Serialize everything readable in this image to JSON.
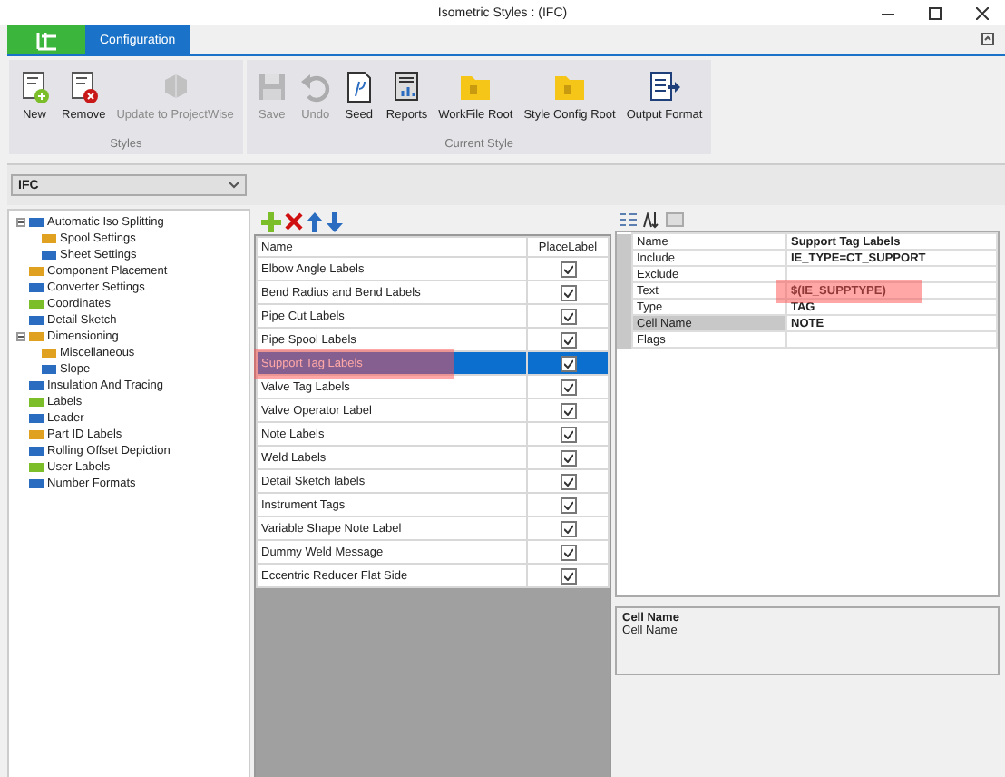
{
  "window": {
    "title": "Isometric Styles : (IFC)"
  },
  "ribbon": {
    "tabs": [
      {
        "label": "Configuration",
        "selected": true
      }
    ],
    "groups": [
      {
        "label": "Styles",
        "buttons": [
          {
            "label": "New",
            "kind": "new",
            "disabled": false
          },
          {
            "label": "Remove",
            "kind": "remove",
            "disabled": false
          },
          {
            "label": "Update to ProjectWise",
            "kind": "update",
            "disabled": true
          }
        ]
      },
      {
        "label": "Current Style",
        "buttons": [
          {
            "label": "Save",
            "kind": "save",
            "disabled": true
          },
          {
            "label": "Undo",
            "kind": "undo",
            "disabled": true
          },
          {
            "label": "Seed",
            "kind": "seed",
            "disabled": false
          },
          {
            "label": "Reports",
            "kind": "reports",
            "disabled": false
          },
          {
            "label": "WorkFile Root",
            "kind": "folder",
            "disabled": false
          },
          {
            "label": "Style Config Root",
            "kind": "folder",
            "disabled": false
          },
          {
            "label": "Output Format",
            "kind": "format",
            "disabled": false
          }
        ]
      }
    ]
  },
  "style_select": {
    "value": "IFC"
  },
  "tree": [
    {
      "label": "Automatic Iso Splitting",
      "expanded": true,
      "children": [
        {
          "label": "Spool Settings"
        },
        {
          "label": "Sheet Settings"
        }
      ]
    },
    {
      "label": "Component Placement"
    },
    {
      "label": "Converter Settings"
    },
    {
      "label": "Coordinates"
    },
    {
      "label": "Detail Sketch"
    },
    {
      "label": "Dimensioning",
      "expanded": true,
      "children": [
        {
          "label": "Miscellaneous"
        },
        {
          "label": "Slope"
        }
      ]
    },
    {
      "label": "Insulation And Tracing"
    },
    {
      "label": "Labels"
    },
    {
      "label": "Leader"
    },
    {
      "label": "Part ID Labels"
    },
    {
      "label": "Rolling Offset Depiction"
    },
    {
      "label": "User Labels"
    },
    {
      "label": "Number Formats"
    }
  ],
  "labels_table": {
    "columns": [
      "Name",
      "PlaceLabel"
    ],
    "rows": [
      {
        "name": "Elbow Angle Labels",
        "checked": true,
        "selected": false
      },
      {
        "name": "Bend Radius and Bend Labels",
        "checked": true,
        "selected": false
      },
      {
        "name": "Pipe Cut Labels",
        "checked": true,
        "selected": false
      },
      {
        "name": "Pipe Spool Labels",
        "checked": true,
        "selected": false
      },
      {
        "name": "Support Tag Labels",
        "checked": true,
        "selected": true
      },
      {
        "name": "Valve Tag Labels",
        "checked": true,
        "selected": false
      },
      {
        "name": "Valve Operator Label",
        "checked": true,
        "selected": false
      },
      {
        "name": "Note Labels",
        "checked": true,
        "selected": false
      },
      {
        "name": "Weld Labels",
        "checked": true,
        "selected": false
      },
      {
        "name": "Detail Sketch labels",
        "checked": true,
        "selected": false
      },
      {
        "name": "Instrument Tags",
        "checked": true,
        "selected": false
      },
      {
        "name": "Variable Shape Note Label",
        "checked": true,
        "selected": false
      },
      {
        "name": "Dummy Weld Message",
        "checked": true,
        "selected": false
      },
      {
        "name": "Eccentric Reducer Flat Side",
        "checked": true,
        "selected": false
      }
    ]
  },
  "properties": {
    "rows": [
      {
        "name": "Name",
        "value": "Support Tag Labels",
        "selected": false
      },
      {
        "name": "Include",
        "value": "IE_TYPE=CT_SUPPORT",
        "selected": false
      },
      {
        "name": "Exclude",
        "selected": false
      },
      {
        "name": "Text",
        "value": "$(IE_SUPPTYPE)",
        "selected": false
      },
      {
        "name": "Type",
        "value": "TAG",
        "selected": false
      },
      {
        "name": "Cell Name",
        "value": "NOTE",
        "selected": true
      },
      {
        "name": "Flags",
        "selected": false
      }
    ],
    "description": {
      "title": "Cell Name",
      "text": "Cell Name"
    }
  }
}
